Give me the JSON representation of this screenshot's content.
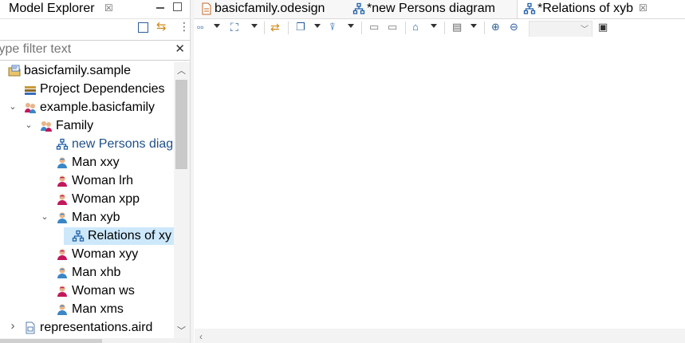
{
  "model_explorer": {
    "title": "Model Explorer",
    "filter": {
      "value": "",
      "placeholder": "type filter text"
    },
    "tree": [
      {
        "label": "basicfamily.sample",
        "icon": "project-icon",
        "twisty": "open"
      },
      {
        "label": "Project Dependencies",
        "icon": "dependencies-icon",
        "twisty": ""
      },
      {
        "label": "example.basicfamily",
        "icon": "family-package-icon",
        "twisty": "open"
      },
      {
        "label": "Family",
        "icon": "family-icon",
        "twisty": "open"
      },
      {
        "label": "new Persons diag",
        "icon": "diagram-icon",
        "twisty": ""
      },
      {
        "label": "Man xxy",
        "icon": "man-icon",
        "twisty": ""
      },
      {
        "label": "Woman lrh",
        "icon": "woman-icon",
        "twisty": ""
      },
      {
        "label": "Woman xpp",
        "icon": "woman-icon",
        "twisty": ""
      },
      {
        "label": "Man xyb",
        "icon": "man-icon",
        "twisty": "open"
      },
      {
        "label": "Relations of xy",
        "icon": "diagram-icon",
        "twisty": "",
        "selected": true
      },
      {
        "label": "Woman xyy",
        "icon": "woman-icon",
        "twisty": ""
      },
      {
        "label": "Man xhb",
        "icon": "man-icon",
        "twisty": ""
      },
      {
        "label": "Woman ws",
        "icon": "woman-icon",
        "twisty": ""
      },
      {
        "label": "Man xms",
        "icon": "man-icon",
        "twisty": ""
      },
      {
        "label": "representations.aird",
        "icon": "aird-file-icon",
        "twisty": "closed"
      }
    ]
  },
  "editor": {
    "tabs": [
      {
        "label": "basicfamily.odesign",
        "icon": "odesign-file-icon"
      },
      {
        "label": "*new Persons diagram",
        "icon": "diagram-icon"
      },
      {
        "label": "*Relations of xyb",
        "icon": "diagram-icon",
        "active": true
      }
    ],
    "zoom_value": ""
  },
  "colors": {
    "selection": "#cde8fb",
    "diagram_icon": "#1f5fa8",
    "man_icon": "#3a86c6",
    "woman_icon": "#c2185b"
  }
}
